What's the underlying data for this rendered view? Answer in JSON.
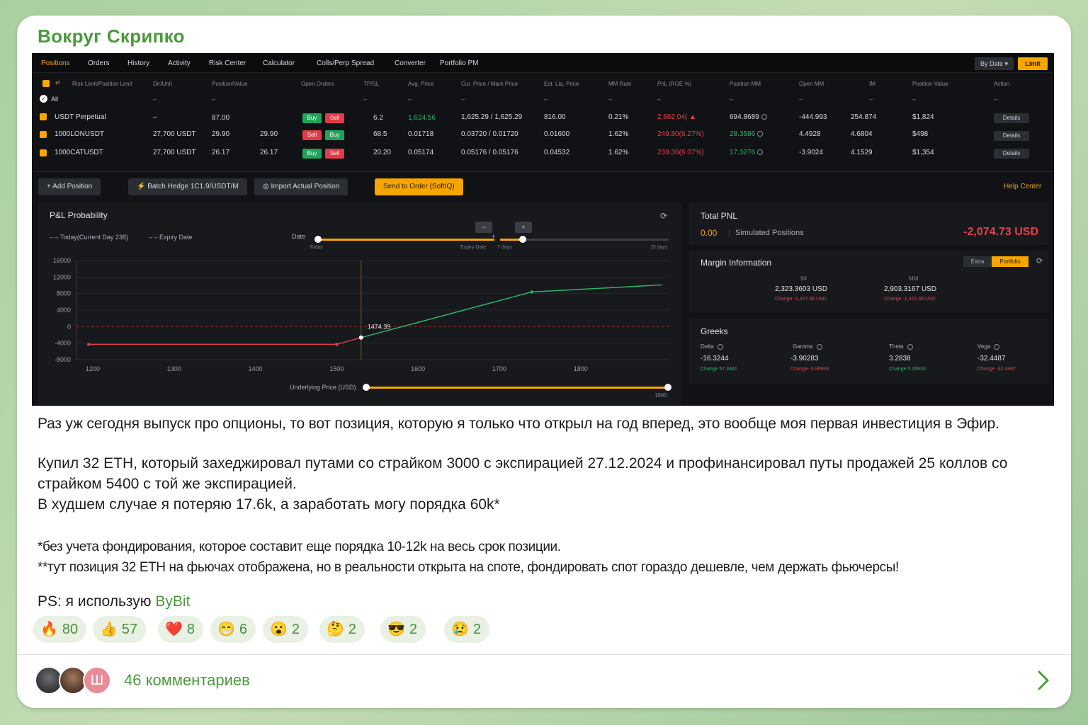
{
  "channel": {
    "name": "Вокруг Скрипко"
  },
  "app": {
    "tabs": [
      "Positions",
      "Orders",
      "History",
      "Activity",
      "Risk Center",
      "Calculator",
      "Colls/Perp Spread",
      "Converter",
      "Portfolio PM"
    ],
    "by_date": "By Date",
    "limit": "Limit",
    "headers": {
      "risk_limit": "Risk Limit/Position Limit",
      "dir_unit": "Dir/Unit",
      "position_value": "Position/Value",
      "open_orders": "Open Orders",
      "tpsl": "TP/SL",
      "avg_price": "Avg. Price",
      "cur_mark": "Cur. Price / Mark Price",
      "est_liq": "Est. Liq. Price",
      "mm_rate": "MM Rate",
      "pnl": "PnL (ROE %)",
      "position_mm": "Position MM",
      "open_mm": "Open MM",
      "im": "IM",
      "pos_value": "Position Value",
      "action": "Action"
    },
    "all_label": "All",
    "dash": "–",
    "rows": [
      {
        "symbol": "USDT Perpetual",
        "dir_unit": "–",
        "pos": "87.00",
        "pos2": "",
        "btn1": "Buy",
        "btn2": "Sell",
        "btn1_type": "buy",
        "tpsl": "6.2",
        "avg": "1,624.56",
        "cur": "1,625.29 / 1,625.29",
        "liq": "816.00",
        "mm_rate": "0.21%",
        "pnl": "2,662.04(",
        "pos_mm": "694.8689",
        "open_mm": "-444.993",
        "im": "254.874",
        "value": "$1,824",
        "action": "Details"
      },
      {
        "symbol": "1000LONUSDT",
        "dir_unit": "27,700 USDT",
        "pos": "29.90",
        "pos2": "29.90",
        "btn1": "Sell",
        "btn2": "Buy",
        "btn1_type": "sell",
        "tpsl": "68.5",
        "avg": "0.01718",
        "cur": "0.03720 / 0.01720",
        "liq": "0.01600",
        "mm_rate": "1.62%",
        "pnl": "249.80(6.27%)",
        "pos_mm": "28.3586",
        "open_mm": "4.4928",
        "im": "4.6804",
        "value": "$498",
        "action": "Details"
      },
      {
        "symbol": "1000CATUSDT",
        "dir_unit": "27,700 USDT",
        "pos": "26.17",
        "pos2": "26.17",
        "btn1": "Buy",
        "btn2": "Sell",
        "btn1_type": "buy",
        "tpsl": "20.20",
        "avg": "0.05174",
        "cur": "0.05176 / 0.05176",
        "liq": "0.04532",
        "mm_rate": "1.62%",
        "pnl": "239.36(6.07%)",
        "pos_mm": "17.3276",
        "open_mm": "-3.9024",
        "im": "4.1529",
        "value": "$1,354",
        "action": "Details"
      }
    ],
    "actions": {
      "add_position": "+ Add Position",
      "batch_hedge": "Batch Hedge 1C1.9/USDT/M",
      "import_position": "Import Actual Position",
      "send_order": "Send to Order (SoftIQ)",
      "help_center": "Help Center"
    },
    "pl": {
      "title": "P&L Probability",
      "legend_today": "Today(Current Day 238)",
      "legend_expiry": "Expiry Date",
      "date_label": "Date",
      "slider_today": "Today",
      "slider_expiry": "Expiry Date",
      "slider_7d": "7 days",
      "slider_15d": "15 days",
      "minus": "−",
      "plus": "+",
      "underlying_label": "Underlying Price (USD)",
      "underlying_max": "1895"
    },
    "total_pnl": {
      "title": "Total PNL",
      "sim_value": "0.00",
      "sim_label": "Simulated Positions",
      "value": "-2,074.73 USD"
    },
    "margin": {
      "title": "Margin Information",
      "tab_extra": "Extra",
      "tab_portfolio": "Portfolio",
      "im_label": "IM",
      "im_value": "2,323.3603 USD",
      "im_change": "Change -1,474.38 USD",
      "mm_label": "MM",
      "mm_value": "2,903.3167 USD",
      "mm_change": "Change -1,474.38 USD"
    },
    "greeks": {
      "title": "Greeks",
      "items": [
        {
          "name": "Delta",
          "value": "-16.3244",
          "change": "Change 57.4841",
          "up": true
        },
        {
          "name": "Gamma",
          "value": "-3.90283",
          "change": "Change -3.88903",
          "up": false
        },
        {
          "name": "Theta",
          "value": "3.2838",
          "change": "Change 5.26633",
          "up": true
        },
        {
          "name": "Vega",
          "value": "-32.4487",
          "change": "Change -32.4487",
          "up": false
        }
      ]
    },
    "colors": {
      "accent": "#f7a600",
      "green": "#2db46a",
      "red": "#e5404d",
      "bg": "#101215"
    }
  },
  "chart_data": {
    "type": "line",
    "title": "P&L Probability",
    "xlim": [
      1180,
      1910
    ],
    "ylim": [
      -8000,
      16000
    ],
    "x_ticks": [
      "1200",
      "1300",
      "1400",
      "1500",
      "1600",
      "1700",
      "1800"
    ],
    "y_ticks": [
      "16000",
      "12000",
      "8000",
      "4000",
      "0",
      "-4000",
      "-8000"
    ],
    "series": [
      {
        "name": "Today(Current Day 238)",
        "x": [
          1195,
          1500,
          1530,
          1740,
          1900
        ],
        "y": [
          -4300,
          -4300,
          -2650,
          8400,
          10100
        ]
      }
    ],
    "marker_x": 1530,
    "annotation": "1474.39",
    "grid": true
  },
  "post": {
    "p1": "Раз уж сегодня выпуск про опционы, то вот позиция, которую я только что открыл на год вперед, это вообще моя первая инвестиция в Эфир.",
    "p2": "Купил 32 ETH, который захеджировал путами со страйком 3000 с экспирацией 27.12.2024 и профинансировал путы продажей 25 коллов со страйком 5400 с той же экспирацией.",
    "p3": "В худшем случае я потеряю 17.6k, а заработать могу порядка 60k*",
    "p4": "*без учета фондирования, которое составит еще порядка 10-12k на весь срок позиции.",
    "p5": "**тут позиция 32 ETH на фьючах отображена, но в реальности открыта на споте, фондировать спот гораздо дешевле, чем держать фьючерсы!",
    "ps_prefix": "PS: я использую ",
    "ps_link": "ByBit"
  },
  "reactions": [
    {
      "emoji": "🔥",
      "count": "80"
    },
    {
      "emoji": "👍",
      "count": "57"
    },
    {
      "emoji": "❤️",
      "count": "8"
    },
    {
      "emoji": "😁",
      "count": "6"
    },
    {
      "emoji": "😮",
      "count": "2"
    },
    {
      "emoji": "🤔",
      "count": "2"
    },
    {
      "emoji": "😎",
      "count": "2"
    },
    {
      "emoji": "😢",
      "count": "2"
    }
  ],
  "footer": {
    "avatar_letter": "Ш",
    "comments": "46 комментариев"
  }
}
